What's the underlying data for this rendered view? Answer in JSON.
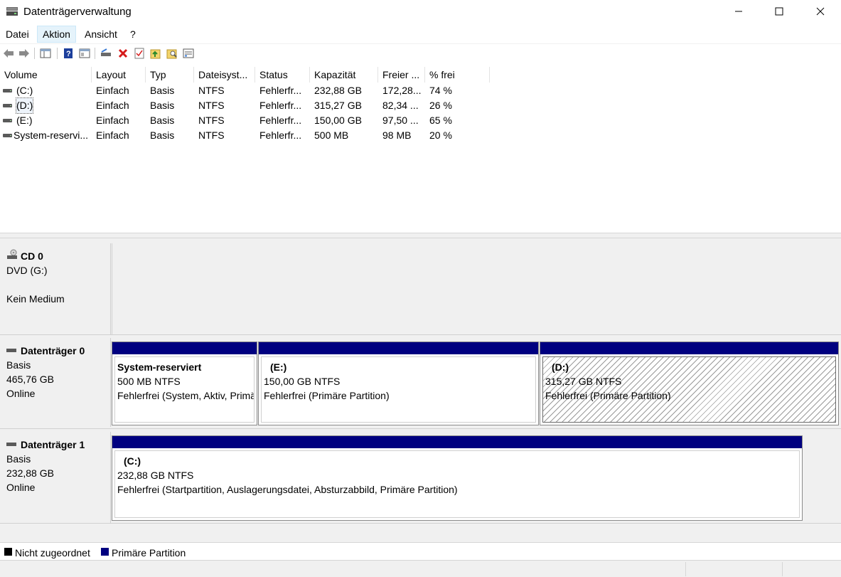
{
  "window": {
    "title": "Datenträgerverwaltung",
    "app_icon": "disk-management-icon"
  },
  "menu": [
    {
      "label": "Datei",
      "active": false
    },
    {
      "label": "Aktion",
      "active": true
    },
    {
      "label": "Ansicht",
      "active": false
    },
    {
      "label": "?",
      "active": false
    }
  ],
  "toolbar": [
    "back-icon",
    "forward-icon",
    "show-hide-console-tree-icon",
    "help-icon",
    "properties-icon",
    "connect-disk-icon",
    "delete-icon",
    "check-icon",
    "up-icon",
    "search-icon",
    "settings-icon"
  ],
  "list": {
    "columns": [
      "Volume",
      "Layout",
      "Typ",
      "Dateisyst...",
      "Status",
      "Kapazität",
      "Freier ...",
      "% frei"
    ],
    "rows": [
      {
        "volume": "(C:)",
        "layout": "Einfach",
        "typ": "Basis",
        "fs": "NTFS",
        "status": "Fehlerfr...",
        "kapazitaet": "232,88 GB",
        "frei": "172,28...",
        "pct": "74 %"
      },
      {
        "volume": "(D:)",
        "layout": "Einfach",
        "typ": "Basis",
        "fs": "NTFS",
        "status": "Fehlerfr...",
        "kapazitaet": "315,27 GB",
        "frei": "82,34 ...",
        "pct": "26 %"
      },
      {
        "volume": "(E:)",
        "layout": "Einfach",
        "typ": "Basis",
        "fs": "NTFS",
        "status": "Fehlerfr...",
        "kapazitaet": "150,00 GB",
        "frei": "97,50 ...",
        "pct": "65 %"
      },
      {
        "volume": "System-reservi...",
        "layout": "Einfach",
        "typ": "Basis",
        "fs": "NTFS",
        "status": "Fehlerfr...",
        "kapazitaet": "500 MB",
        "frei": "98 MB",
        "pct": "20 %"
      }
    ]
  },
  "disks": {
    "cd0": {
      "title": "CD 0",
      "line1": "DVD (G:)",
      "line2": "Kein Medium"
    },
    "disk0": {
      "title": "Datenträger 0",
      "type": "Basis",
      "size": "465,76 GB",
      "state": "Online",
      "partitions": [
        {
          "name": "System-reserviert",
          "size": "500 MB NTFS",
          "status": "Fehlerfrei (System, Aktiv, Primäre Partition)"
        },
        {
          "name": "(E:)",
          "size": "150,00 GB NTFS",
          "status": "Fehlerfrei (Primäre Partition)"
        },
        {
          "name": "(D:)",
          "size": "315,27 GB NTFS",
          "status": "Fehlerfrei (Primäre Partition)"
        }
      ]
    },
    "disk1": {
      "title": "Datenträger 1",
      "type": "Basis",
      "size": "232,88 GB",
      "state": "Online",
      "partitions": [
        {
          "name": "(C:)",
          "size": "232,88 GB NTFS",
          "status": "Fehlerfrei (Startpartition, Auslagerungsdatei, Absturzabbild, Primäre Partition)"
        }
      ]
    }
  },
  "legend": {
    "unallocated": {
      "label": "Nicht zugeordnet",
      "color": "#000000"
    },
    "primary": {
      "label": "Primäre Partition",
      "color": "#000080"
    }
  }
}
